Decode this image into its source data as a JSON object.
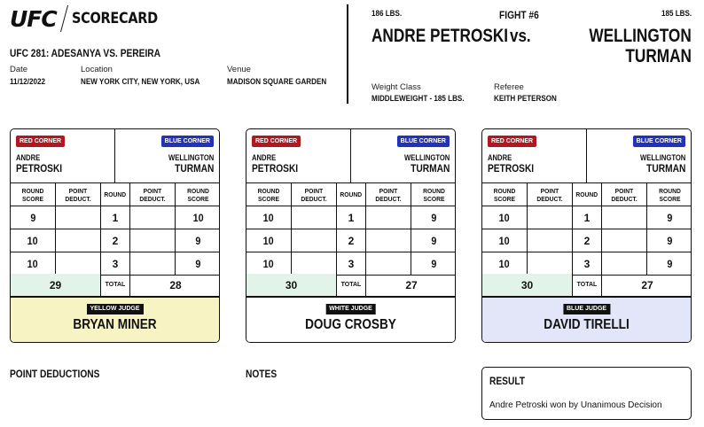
{
  "header": {
    "logo_text": "UFC",
    "logo_subtitle": "SCORECARD",
    "event_title": "UFC 281: ADESANYA VS. PEREIRA",
    "date_label": "Date",
    "date_value": "11/12/2022",
    "location_label": "Location",
    "location_value": "NEW YORK CITY, NEW YORK, USA",
    "venue_label": "Venue",
    "venue_value": "MADISON SQUARE GARDEN"
  },
  "fight": {
    "number": "FIGHT #6",
    "vs_text": "vs.",
    "red_weight": "186 LBS.",
    "blue_weight": "185 LBS.",
    "red_fighter": "ANDRE PETROSKI",
    "blue_fighter_line1": "WELLINGTON",
    "blue_fighter_line2": "TURMAN",
    "weight_class_label": "Weight Class",
    "weight_class_value": "MIDDLEWEIGHT - 185 LBS.",
    "referee_label": "Referee",
    "referee_value": "KEITH PETERSON"
  },
  "card_labels": {
    "red_corner": "RED CORNER",
    "blue_corner": "BLUE CORNER",
    "red_first": "ANDRE",
    "red_last": "PETROSKI",
    "blue_first": "WELLINGTON",
    "blue_last": "TURMAN",
    "round_score": "ROUND SCORE",
    "point_deduct": "POINT DEDUCT.",
    "round": "ROUND",
    "total": "TOTAL"
  },
  "scorecards": [
    {
      "judge_badge": "YELLOW JUDGE",
      "judge_name": "BRYAN MINER",
      "judge_color": "#f7f3c2",
      "rounds": [
        {
          "round": "1",
          "red": "9",
          "blue": "10"
        },
        {
          "round": "2",
          "red": "10",
          "blue": "9"
        },
        {
          "round": "3",
          "red": "10",
          "blue": "9"
        }
      ],
      "red_total": "29",
      "blue_total": "28"
    },
    {
      "judge_badge": "WHITE JUDGE",
      "judge_name": "DOUG CROSBY",
      "judge_color": "#ffffff",
      "rounds": [
        {
          "round": "1",
          "red": "10",
          "blue": "9"
        },
        {
          "round": "2",
          "red": "10",
          "blue": "9"
        },
        {
          "round": "3",
          "red": "10",
          "blue": "9"
        }
      ],
      "red_total": "30",
      "blue_total": "27"
    },
    {
      "judge_badge": "BLUE JUDGE",
      "judge_name": "DAVID TIRELLI",
      "judge_color": "#e3e6f8",
      "rounds": [
        {
          "round": "1",
          "red": "10",
          "blue": "9"
        },
        {
          "round": "2",
          "red": "10",
          "blue": "9"
        },
        {
          "round": "3",
          "red": "10",
          "blue": "9"
        }
      ],
      "red_total": "30",
      "blue_total": "27"
    }
  ],
  "footer": {
    "point_deductions_label": "POINT DEDUCTIONS",
    "notes_label": "NOTES",
    "result_label": "RESULT",
    "result_text": "Andre Petroski won by Unanimous Decision"
  }
}
